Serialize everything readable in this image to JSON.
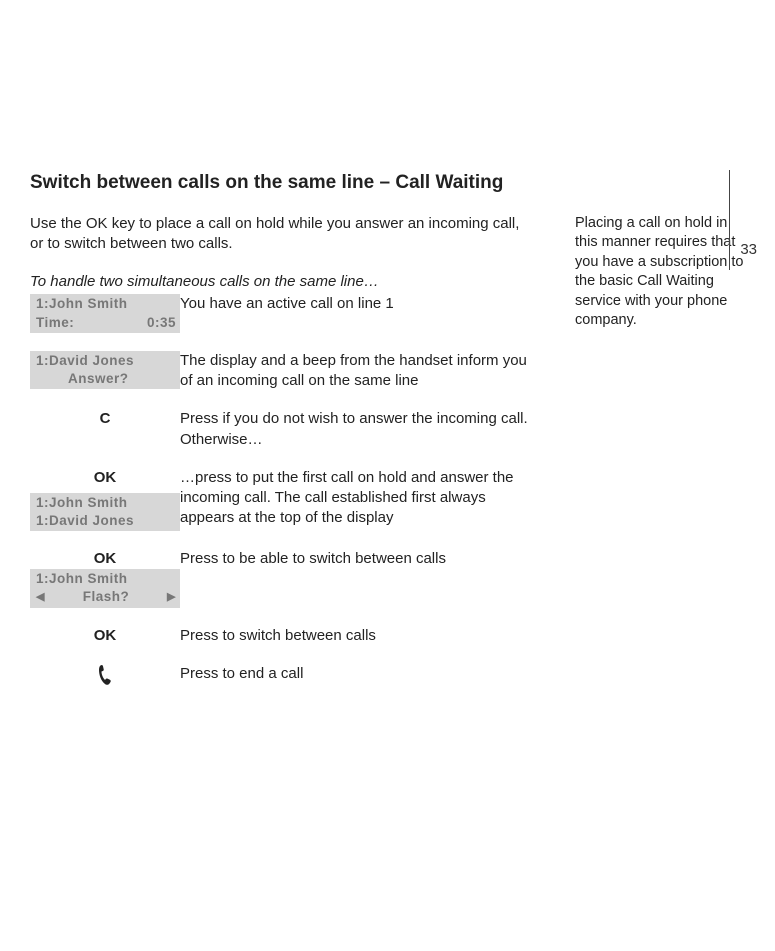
{
  "page_number": "33",
  "heading": "Switch between calls on the same line – Call Waiting",
  "intro": "Use the OK key to place a call on hold while you answer an incoming call, or to switch between two calls.",
  "subhead": "To handle two simultaneous calls on the same line…",
  "side_note": "Placing a call on hold in this manner requires that you have a subscription to the basic Call Waiting service with your phone company.",
  "display1": {
    "line1": "1:John Smith",
    "line2_left": "Time:",
    "line2_right": "0:35"
  },
  "step1_desc": "You have an active call on line 1",
  "display2": {
    "line1": "1:David Jones",
    "line2": "Answer?"
  },
  "step2_desc": "The display and a beep from the handset inform you of an incoming call on the same line",
  "btn_c": "C",
  "step3_desc": "Press if you do not wish to answer the incoming call. Otherwise…",
  "btn_ok": "OK",
  "step4_desc": "…press to put the first call on hold and answer the incoming call. The call established first always appears at the top of the display",
  "display3": {
    "line1": "1:John Smith",
    "line2": "1:David Jones"
  },
  "step5_desc": "Press to be able to switch between calls",
  "display4": {
    "line1": "1:John Smith",
    "flash": "Flash?",
    "left_arrow": "◀",
    "right_arrow": "▶"
  },
  "step6_desc": "Press to switch between calls",
  "step7_desc": "Press to end a call"
}
